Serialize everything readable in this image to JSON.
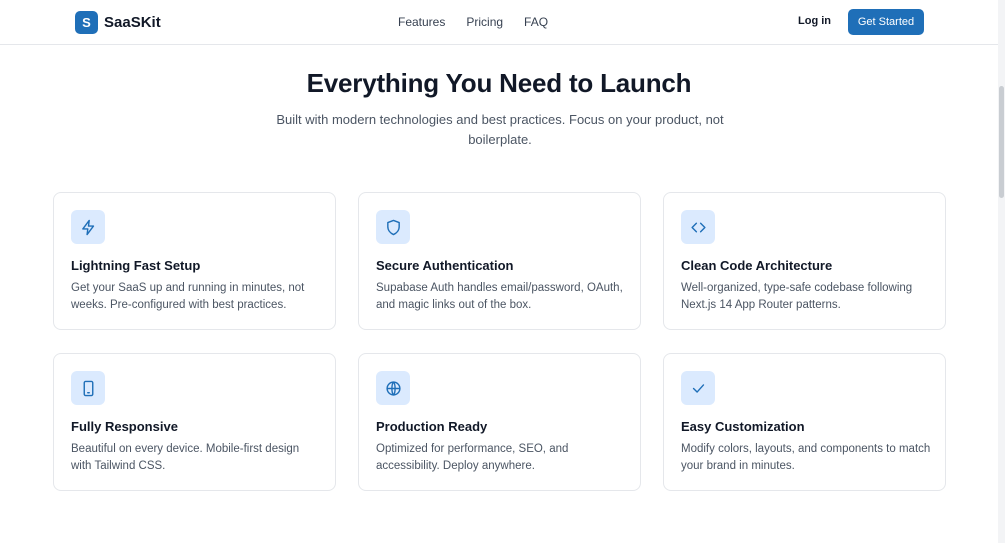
{
  "brand": {
    "logo_letter": "S",
    "name": "SaaSKit"
  },
  "nav": {
    "links": [
      "Features",
      "Pricing",
      "FAQ"
    ],
    "login": "Log in",
    "cta": "Get Started"
  },
  "hero": {
    "title": "Everything You Need to Launch",
    "subtitle": "Built with modern technologies and best practices. Focus on your product, not boilerplate."
  },
  "features": [
    {
      "icon": "lightning-icon",
      "title": "Lightning Fast Setup",
      "desc": "Get your SaaS up and running in minutes, not weeks. Pre-configured with best practices."
    },
    {
      "icon": "shield-icon",
      "title": "Secure Authentication",
      "desc": "Supabase Auth handles email/password, OAuth, and magic links out of the box."
    },
    {
      "icon": "code-icon",
      "title": "Clean Code Architecture",
      "desc": "Well-organized, type-safe codebase following Next.js 14 App Router patterns."
    },
    {
      "icon": "mobile-icon",
      "title": "Fully Responsive",
      "desc": "Beautiful on every device. Mobile-first design with Tailwind CSS."
    },
    {
      "icon": "globe-icon",
      "title": "Production Ready",
      "desc": "Optimized for performance, SEO, and accessibility. Deploy anywhere."
    },
    {
      "icon": "check-icon",
      "title": "Easy Customization",
      "desc": "Modify colors, layouts, and components to match your brand in minutes."
    }
  ],
  "colors": {
    "accent": "#1f6fb8",
    "icon_bg": "#dbeafe"
  }
}
